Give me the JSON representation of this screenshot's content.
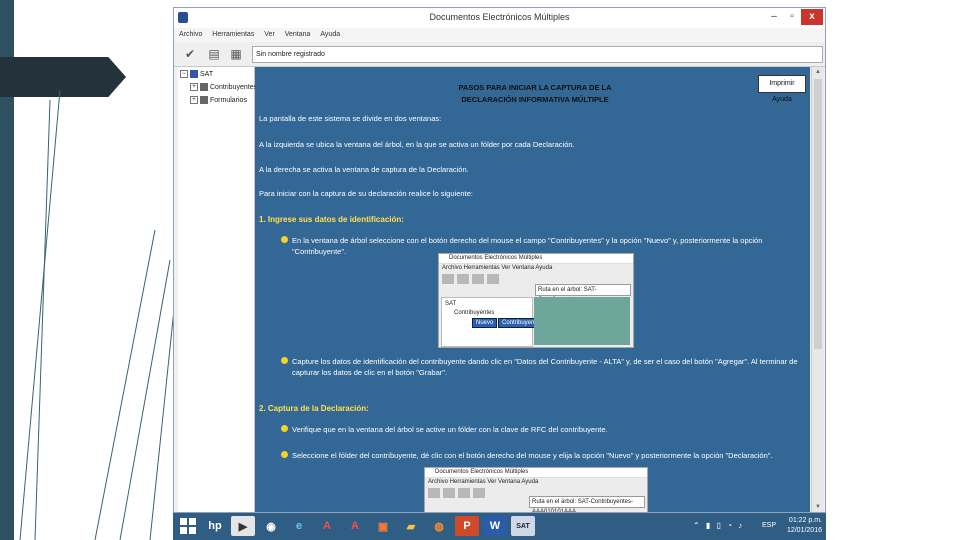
{
  "window": {
    "title": "Documentos Electrónicos Múltiples",
    "controls": {
      "minimize": "–",
      "maximize": "▫",
      "close": "x"
    },
    "menu": [
      "Archivo",
      "Herramientas",
      "Ver",
      "Ventana",
      "Ayuda"
    ],
    "address": "Sin nombre registrado"
  },
  "tree": {
    "root": "SAT",
    "items": [
      "Contribuyentes",
      "Formularios"
    ]
  },
  "content": {
    "print_button": "Imprimir Ayuda",
    "heading_line1": "PASOS PARA INICIAR LA CAPTURA DE LA",
    "heading_line2": "DECLARACIÓN INFORMATIVA MÚLTIPLE",
    "intro1": "La pantalla de este sistema se divide en dos ventanas:",
    "intro2": "A la izquierda se ubica la ventana del árbol, en la que se activa un fólder por cada Declaración.",
    "intro3": "A la derecha se activa la ventana de captura de la Declaración.",
    "intro4": "Para iniciar con la captura de su declaración realice lo siguiente:",
    "section1": "1. Ingrese sus datos de identificación:",
    "bullet1": "En la ventana de árbol seleccione con el botón derecho del mouse el campo \"Contribuyentes\" y la opción \"Nuevo\" y, posteriormente la opción \"Contribuyente\".",
    "bullet2": "Capture los datos de identificación del contribuyente dando clic en \"Datos del Contribuyente - ALTA\" y, de ser el caso del botón \"Agregar\". Al terminar de capturar los datos de clic en el botón \"Grabar\".",
    "section2": "2. Captura de la Declaración:",
    "bullet3": "Verifique que en la ventana del árbol se active un fólder con la clave de RFC del contribuyente.",
    "bullet4": "Seleccione el fólder del contribuyente, dé clic con el botón derecho del mouse y elija la opción \"Nuevo\" y posteriormente la opción \"Declaración\"."
  },
  "shot1": {
    "title": "Documentos Electrónicos Múltiples",
    "menu": "Archivo   Herramientas   Ver   Ventana   Ayuda",
    "address": "Ruta en el árbol: SAT-Contribuyentes",
    "tree_root": "SAT",
    "tree_item": "Contribuyentes",
    "popup_new": "Nuevo",
    "popup_sub": "Contribuyente"
  },
  "shot2": {
    "title": "Documentos Electrónicos Múltiples",
    "menu": "Archivo   Herramientas   Ver   Ventana   Ayuda",
    "address": "Ruta en el árbol: SAT-Contribuyentes-AAA010101AAA"
  },
  "taskbar": {
    "apps": [
      "HP",
      "Media",
      "Chrome",
      "IE",
      "Acrobat",
      "Acrobat",
      "PDF",
      "Explorer",
      "Firefox",
      "PowerPoint",
      "Word",
      "SAT"
    ],
    "lang": "ESP",
    "time": "01:22 p.m.",
    "date": "12/01/2016"
  },
  "colors": {
    "content_bg": "#336796",
    "section_title": "#ffe14c",
    "taskbar": "#2f5d84",
    "close_button": "#c7352b"
  }
}
